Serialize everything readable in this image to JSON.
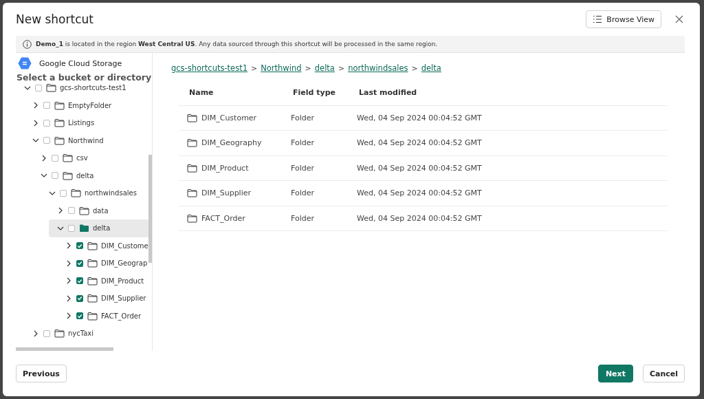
{
  "dialog": {
    "title": "New shortcut",
    "browse_view_button": "Browse View"
  },
  "info_bar": {
    "text": "**Demo_1** is located in the region **West Central US**. Any data sourced through this shortcut will be processed in the same region."
  },
  "source": {
    "name": "Google Cloud Storage",
    "prompt": "Select a bucket or directory"
  },
  "tree": [
    {
      "label": "gcs-shortcuts-test1",
      "expanded": true,
      "checked": false,
      "selected": false,
      "children": [
        {
          "label": "EmptyFolder",
          "expanded": false,
          "checked": false,
          "selected": false
        },
        {
          "label": "Listings",
          "expanded": false,
          "checked": false,
          "selected": false
        },
        {
          "label": "Northwind",
          "expanded": true,
          "checked": false,
          "selected": false,
          "children": [
            {
              "label": "csv",
              "expanded": false,
              "checked": false,
              "selected": false
            },
            {
              "label": "delta",
              "expanded": true,
              "checked": false,
              "selected": false,
              "children": [
                {
                  "label": "northwindsales",
                  "expanded": true,
                  "checked": false,
                  "selected": false,
                  "children": [
                    {
                      "label": "data",
                      "expanded": false,
                      "checked": false,
                      "selected": false
                    },
                    {
                      "label": "delta",
                      "expanded": true,
                      "checked": false,
                      "selected": true,
                      "children": [
                        {
                          "label": "DIM_Custome",
                          "expanded": false,
                          "checked": true,
                          "selected": false
                        },
                        {
                          "label": "DIM_Geograp",
                          "expanded": false,
                          "checked": true,
                          "selected": false
                        },
                        {
                          "label": "DIM_Product",
                          "expanded": false,
                          "checked": true,
                          "selected": false
                        },
                        {
                          "label": "DIM_Supplier",
                          "expanded": false,
                          "checked": true,
                          "selected": false
                        },
                        {
                          "label": "FACT_Order",
                          "expanded": false,
                          "checked": true,
                          "selected": false
                        }
                      ]
                    }
                  ]
                }
              ]
            }
          ]
        },
        {
          "label": "nycTaxi",
          "expanded": false,
          "checked": false,
          "selected": false
        }
      ]
    }
  ],
  "breadcrumb": [
    {
      "kind": "link",
      "text": "gcs-shortcuts-test1"
    },
    {
      "kind": "separator",
      "text": ">"
    },
    {
      "kind": "link",
      "text": "Northwind"
    },
    {
      "kind": "separator",
      "text": ">"
    },
    {
      "kind": "link",
      "text": "delta"
    },
    {
      "kind": "separator",
      "text": ">"
    },
    {
      "kind": "link",
      "text": "northwindsales"
    },
    {
      "kind": "separator",
      "text": ">"
    },
    {
      "kind": "link",
      "text": "delta"
    }
  ],
  "table": {
    "columns": [
      "Name",
      "Field type",
      "Last modified"
    ],
    "rows": [
      [
        "DIM_Customer",
        "Folder",
        "Wed, 04 Sep 2024 00:04:52 GMT"
      ],
      [
        "DIM_Geography",
        "Folder",
        "Wed, 04 Sep 2024 00:04:52 GMT"
      ],
      [
        "DIM_Product",
        "Folder",
        "Wed, 04 Sep 2024 00:04:52 GMT"
      ],
      [
        "DIM_Supplier",
        "Folder",
        "Wed, 04 Sep 2024 00:04:52 GMT"
      ],
      [
        "FACT_Order",
        "Folder",
        "Wed, 04 Sep 2024 00:04:52 GMT"
      ]
    ]
  },
  "footer": {
    "previous": "Previous",
    "next": "Next",
    "cancel": "Cancel"
  }
}
